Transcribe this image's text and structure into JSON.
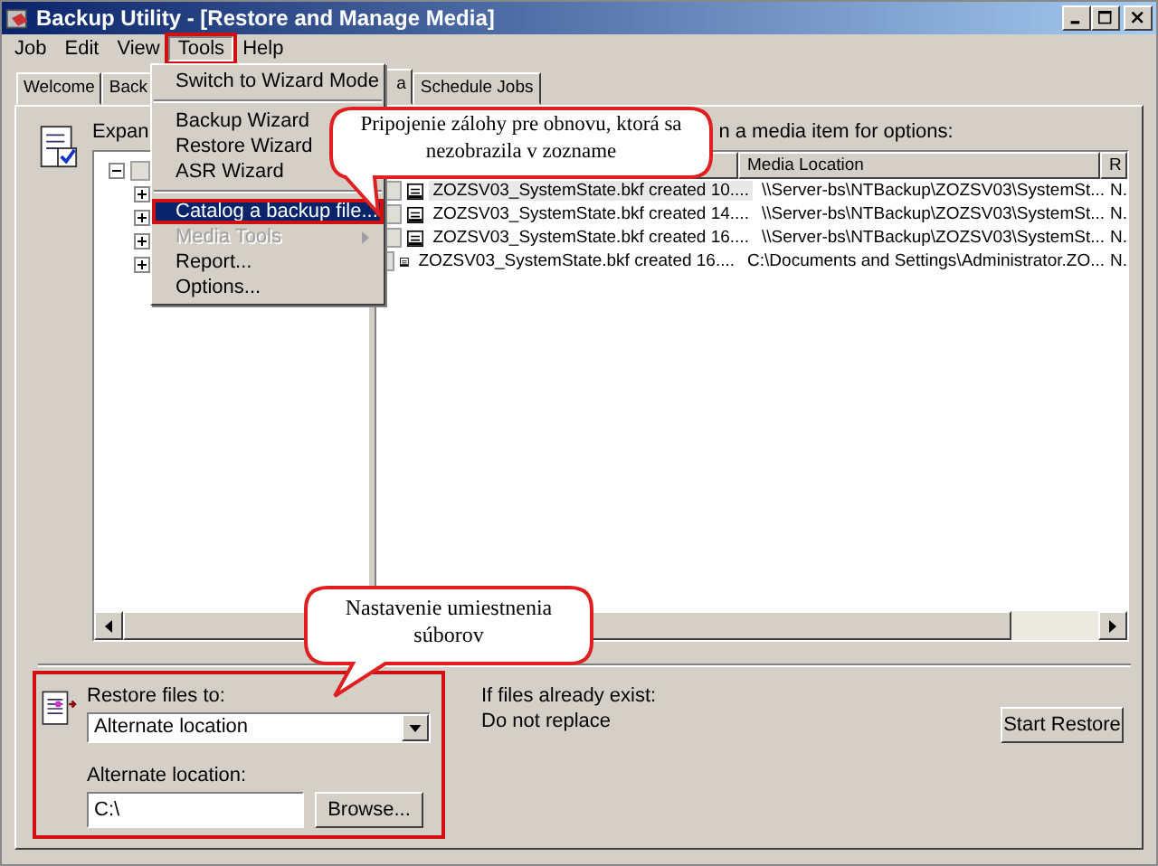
{
  "window": {
    "title": "Backup Utility - [Restore and Manage Media]"
  },
  "menu_bar": [
    {
      "label": "Job",
      "selected": false
    },
    {
      "label": "Edit",
      "selected": false
    },
    {
      "label": "View",
      "selected": false
    },
    {
      "label": "Tools",
      "selected": true,
      "highlighted": true
    },
    {
      "label": "Help",
      "selected": false
    }
  ],
  "tabs": [
    {
      "label": "Welcome",
      "selected": false
    },
    {
      "label": "Back",
      "selected": false
    },
    {
      "label": "a",
      "selected": true
    },
    {
      "label": "Schedule Jobs",
      "selected": false
    }
  ],
  "tools_menu": [
    {
      "kind": "item",
      "label": "Switch to Wizard Mode",
      "selected": false,
      "disabled": false,
      "submenu": false,
      "highlighted": false
    },
    {
      "kind": "separator"
    },
    {
      "kind": "item",
      "label": "Backup Wizard",
      "selected": false,
      "disabled": false,
      "submenu": false,
      "highlighted": false
    },
    {
      "kind": "item",
      "label": "Restore Wizard",
      "selected": false,
      "disabled": false,
      "submenu": false,
      "highlighted": false
    },
    {
      "kind": "item",
      "label": "ASR Wizard",
      "selected": false,
      "disabled": false,
      "submenu": false,
      "highlighted": false
    },
    {
      "kind": "separator"
    },
    {
      "kind": "item",
      "label": "Catalog a backup file...",
      "selected": true,
      "disabled": false,
      "submenu": false,
      "highlighted": true
    },
    {
      "kind": "item",
      "label": "Media Tools",
      "selected": false,
      "disabled": true,
      "submenu": true,
      "highlighted": false
    },
    {
      "kind": "item",
      "label": "Report...",
      "selected": false,
      "disabled": false,
      "submenu": false,
      "highlighted": false
    },
    {
      "kind": "item",
      "label": "Options...",
      "selected": false,
      "disabled": false,
      "submenu": false,
      "highlighted": false
    }
  ],
  "tree": {
    "label": "Expan",
    "nodes": [
      {
        "expanded": true,
        "checked": false,
        "children": [
          {
            "expanded": false
          },
          {
            "expanded": false
          },
          {
            "expanded": false
          },
          {
            "expanded": false
          }
        ]
      }
    ]
  },
  "media_list": {
    "hint": "n a media item for options:",
    "columns": [
      "Media Location",
      "R"
    ],
    "rows": [
      {
        "selected": true,
        "checked": false,
        "name": "ZOZSV03_SystemState.bkf created 10....",
        "location": "\\\\Server-bs\\NTBackup\\ZOZSV03\\SystemSt...",
        "column_3": "N."
      },
      {
        "selected": false,
        "checked": false,
        "name": "ZOZSV03_SystemState.bkf created 14....",
        "location": "\\\\Server-bs\\NTBackup\\ZOZSV03\\SystemSt...",
        "column_3": "N."
      },
      {
        "selected": false,
        "checked": false,
        "name": "ZOZSV03_SystemState.bkf created 16....",
        "location": "\\\\Server-bs\\NTBackup\\ZOZSV03\\SystemSt...",
        "column_3": "N."
      },
      {
        "selected": false,
        "checked": false,
        "name": "ZOZSV03_SystemState.bkf created 16....",
        "location": "C:\\Documents and Settings\\Administrator.ZO...",
        "column_3": "N."
      }
    ]
  },
  "restore": {
    "highlighted": true,
    "restore_to_label": "Restore files to:",
    "restore_to_value": "Alternate location",
    "alternate_label": "Alternate location:",
    "alternate_value": "C:\\",
    "browse_button": "Browse..."
  },
  "existing_files": {
    "label": "If files already exist:",
    "value": "Do not replace"
  },
  "start_button": "Start Restore",
  "callouts": [
    {
      "kind": "top",
      "text": "Pripojenie zálohy pre obnovu, ktorá sa nezobrazila v zozname"
    },
    {
      "kind": "bottom",
      "text": "Nastavenie umiestnenia súborov"
    }
  ]
}
